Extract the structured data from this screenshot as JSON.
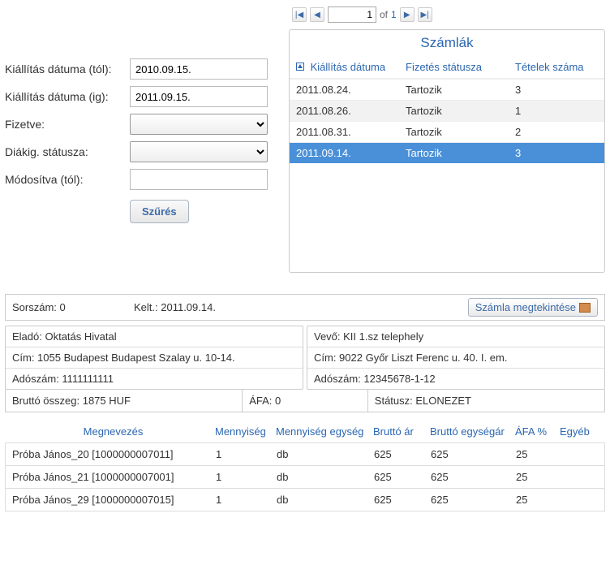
{
  "filter": {
    "labels": {
      "date_from": "Kiállítás dátuma (tól):",
      "date_to": "Kiállítás dátuma (ig):",
      "paid": "Fizetve:",
      "student_status": "Diákig. státusza:",
      "modified_from": "Módosítva (tól):"
    },
    "values": {
      "date_from": "2010.09.15.",
      "date_to": "2011.09.15.",
      "paid": "",
      "student_status": "",
      "modified_from": ""
    },
    "button": "Szűrés"
  },
  "pager": {
    "current": "1",
    "of_text": "of",
    "total": "1"
  },
  "invoice_panel": {
    "title": "Számlák",
    "columns": {
      "date": "Kiállítás dátuma",
      "pay_status": "Fizetés státusza",
      "item_count": "Tételek száma"
    },
    "rows": [
      {
        "date": "2011.08.24.",
        "pay": "Tartozik",
        "count": "3"
      },
      {
        "date": "2011.08.26.",
        "pay": "Tartozik",
        "count": "1"
      },
      {
        "date": "2011.08.31.",
        "pay": "Tartozik",
        "count": "2"
      },
      {
        "date": "2011.09.14.",
        "pay": "Tartozik",
        "count": "3"
      }
    ],
    "selected_index": 3
  },
  "detail": {
    "serial_label": "Sorszám: 0",
    "date_label": "Kelt.: 2011.09.14.",
    "view_button": "Számla megtekintése",
    "seller": {
      "name": "Eladó: Oktatás Hivatal",
      "address": "Cím: 1055 Budapest Budapest Szalay u. 10-14.",
      "tax": "Adószám: 1111111111"
    },
    "buyer": {
      "name": "Vevő: KII 1.sz telephely",
      "address": "Cím: 9022 Győr Liszt Ferenc u. 40. I. em.",
      "tax": "Adószám: 12345678-1-12"
    },
    "sums": {
      "gross": "Bruttó összeg: 1875 HUF",
      "vat": "ÁFA: 0",
      "status": "Státusz: ELONEZET"
    },
    "item_columns": {
      "name": "Megnevezés",
      "qty": "Mennyiség",
      "unit": "Mennyiség egység",
      "gross": "Bruttó ár",
      "unit_price": "Bruttó egységár",
      "vat": "ÁFA %",
      "other": "Egyéb"
    },
    "items": [
      {
        "name": "Próba János_20 [1000000007011]",
        "qty": "1",
        "unit": "db",
        "gross": "625",
        "unit_price": "625",
        "vat": "25",
        "other": ""
      },
      {
        "name": "Próba János_21 [1000000007001]",
        "qty": "1",
        "unit": "db",
        "gross": "625",
        "unit_price": "625",
        "vat": "25",
        "other": ""
      },
      {
        "name": "Próba János_29 [1000000007015]",
        "qty": "1",
        "unit": "db",
        "gross": "625",
        "unit_price": "625",
        "vat": "25",
        "other": ""
      }
    ]
  }
}
